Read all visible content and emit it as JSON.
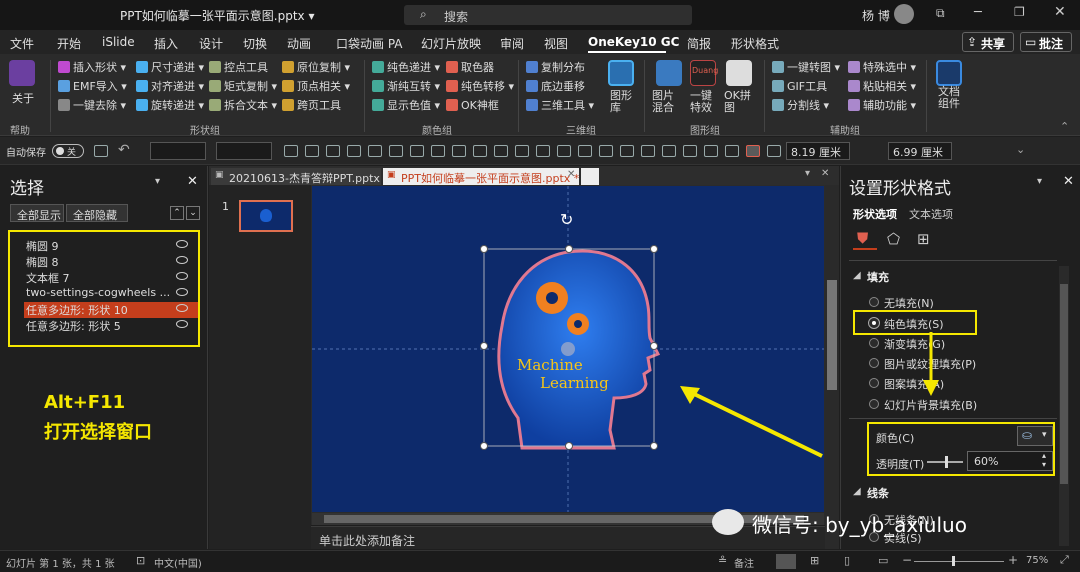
{
  "window": {
    "title": "PPT如何临摹一张平面示意图.pptx ▾",
    "search": "搜索",
    "user": "杨 博",
    "user_initial": "杨"
  },
  "tabs": [
    "文件",
    "开始",
    "iSlide",
    "插入",
    "设计",
    "切换",
    "动画",
    "口袋动画 PA",
    "幻灯片放映",
    "审阅",
    "视图",
    "OneKey10 GC",
    "简报",
    "形状格式"
  ],
  "active_tab": "OneKey10 GC",
  "share": "共享",
  "comment": "批注",
  "ribbon": {
    "about": "关于",
    "help": "帮助",
    "col1": [
      "插入形状 ▾",
      "EMF导入 ▾",
      "一键去除 ▾"
    ],
    "col2": [
      "尺寸递进 ▾",
      "对齐递进 ▾",
      "旋转递进 ▾"
    ],
    "col3": [
      "控点工具",
      "矩式复制 ▾",
      "拆合文本 ▾"
    ],
    "col4": [
      "原位复制 ▾",
      "顶点相关 ▾",
      "跨页工具"
    ],
    "group1": "形状组",
    "col5": [
      "纯色递进 ▾",
      "渐변互转 ▾",
      "显示色值 ▾"
    ],
    "col6": [
      "取色器",
      "纯色转移 ▾",
      "OK神框"
    ],
    "group2": "颜色组",
    "col7": [
      "复制分布",
      "底边垂移",
      "三维工具 ▾"
    ],
    "lib": "图形库",
    "group3": "三维组",
    "col8": [
      "图片混合",
      "一键特效",
      "OK拼图"
    ],
    "group4": "图形组",
    "col9": [
      "一键转图 ▾",
      "GIF工具",
      "分割线 ▾"
    ],
    "col10": [
      "特殊选中 ▾",
      "粘贴相关 ▾",
      "辅助功能 ▾"
    ],
    "group5": "辅助组",
    "doc": "文档组件",
    "duang": "Duang"
  },
  "qat": {
    "autosave": "自动保存",
    "autosave_state": "关",
    "width": "8.19 厘米",
    "height": "6.99 厘米"
  },
  "selection": {
    "title": "选择",
    "show_all": "全部显示",
    "hide_all": "全部隐藏",
    "items": [
      "椭圆 9",
      "椭圆 8",
      "文本框 7",
      "two-settings-cogwheels ...",
      "任意多边形: 形状 10",
      "任意多边形: 形状 5"
    ],
    "selected_index": 4
  },
  "annotation": {
    "line1": "Alt+F11",
    "line2": "打开选择窗口"
  },
  "doc_tabs": [
    "20210613-杰青答辩PPT.pptx",
    "PPT如何临摹一张平面示意图.pptx *"
  ],
  "slide_num": "1",
  "slide_text": {
    "l1": "Machine",
    "l2": "Learning"
  },
  "notes": "单击此处添加备注",
  "format": {
    "title": "设置形状格式",
    "tab1": "形状选项",
    "tab2": "文本选项",
    "fill_header": "填充",
    "fill_opts": [
      "无填充(N)",
      "纯色填充(S)",
      "渐变填充(G)",
      "图片或纹理填充(P)",
      "图案填充(A)",
      "幻灯片背景填充(B)"
    ],
    "color_label": "颜色(C)",
    "transparency_label": "透明度(T)",
    "transparency": "60%",
    "line_header": "线条",
    "line_opts": [
      "无线条(N)",
      "实线(S)"
    ]
  },
  "watermark": "微信号: by_yb_axiuluo",
  "status": {
    "slide": "幻灯片 第 1 张，共 1 张",
    "lang": "中文(中国)",
    "notes": "备注",
    "zoom": "75%"
  },
  "colors": {
    "accent": "#c43e1c",
    "highlight": "#f5e700",
    "slide_bg": "#0d2a6b",
    "head": "#1a5fd0"
  }
}
